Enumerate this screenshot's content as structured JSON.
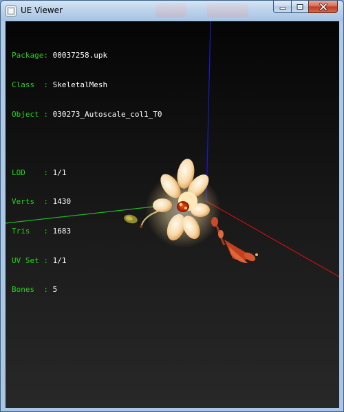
{
  "window": {
    "title": "UE Viewer",
    "icon": "ue-viewer-app-icon",
    "controls": [
      "minimize-icon",
      "maximize-icon",
      "close-icon"
    ]
  },
  "info": {
    "package": {
      "label": "Package:",
      "value": "00037258.upk"
    },
    "class": {
      "label": "Class  :",
      "value": "SkeletalMesh"
    },
    "object": {
      "label": "Object :",
      "value": "030273_Autoscale_col1_T0"
    },
    "lod": {
      "label": "LOD    :",
      "value": "1/1"
    },
    "verts": {
      "label": "Verts  :",
      "value": "1430"
    },
    "tris": {
      "label": "Tris   :",
      "value": "1683"
    },
    "uvset": {
      "label": "UV Set :",
      "value": "1/1"
    },
    "bones": {
      "label": "Bones  :",
      "value": "5"
    }
  },
  "colors": {
    "info_label": "#26d21a",
    "info_value": "#ffffff",
    "axis_x": "#c81010",
    "axis_y": "#1fb81f",
    "axis_z": "#1a1ad0"
  }
}
